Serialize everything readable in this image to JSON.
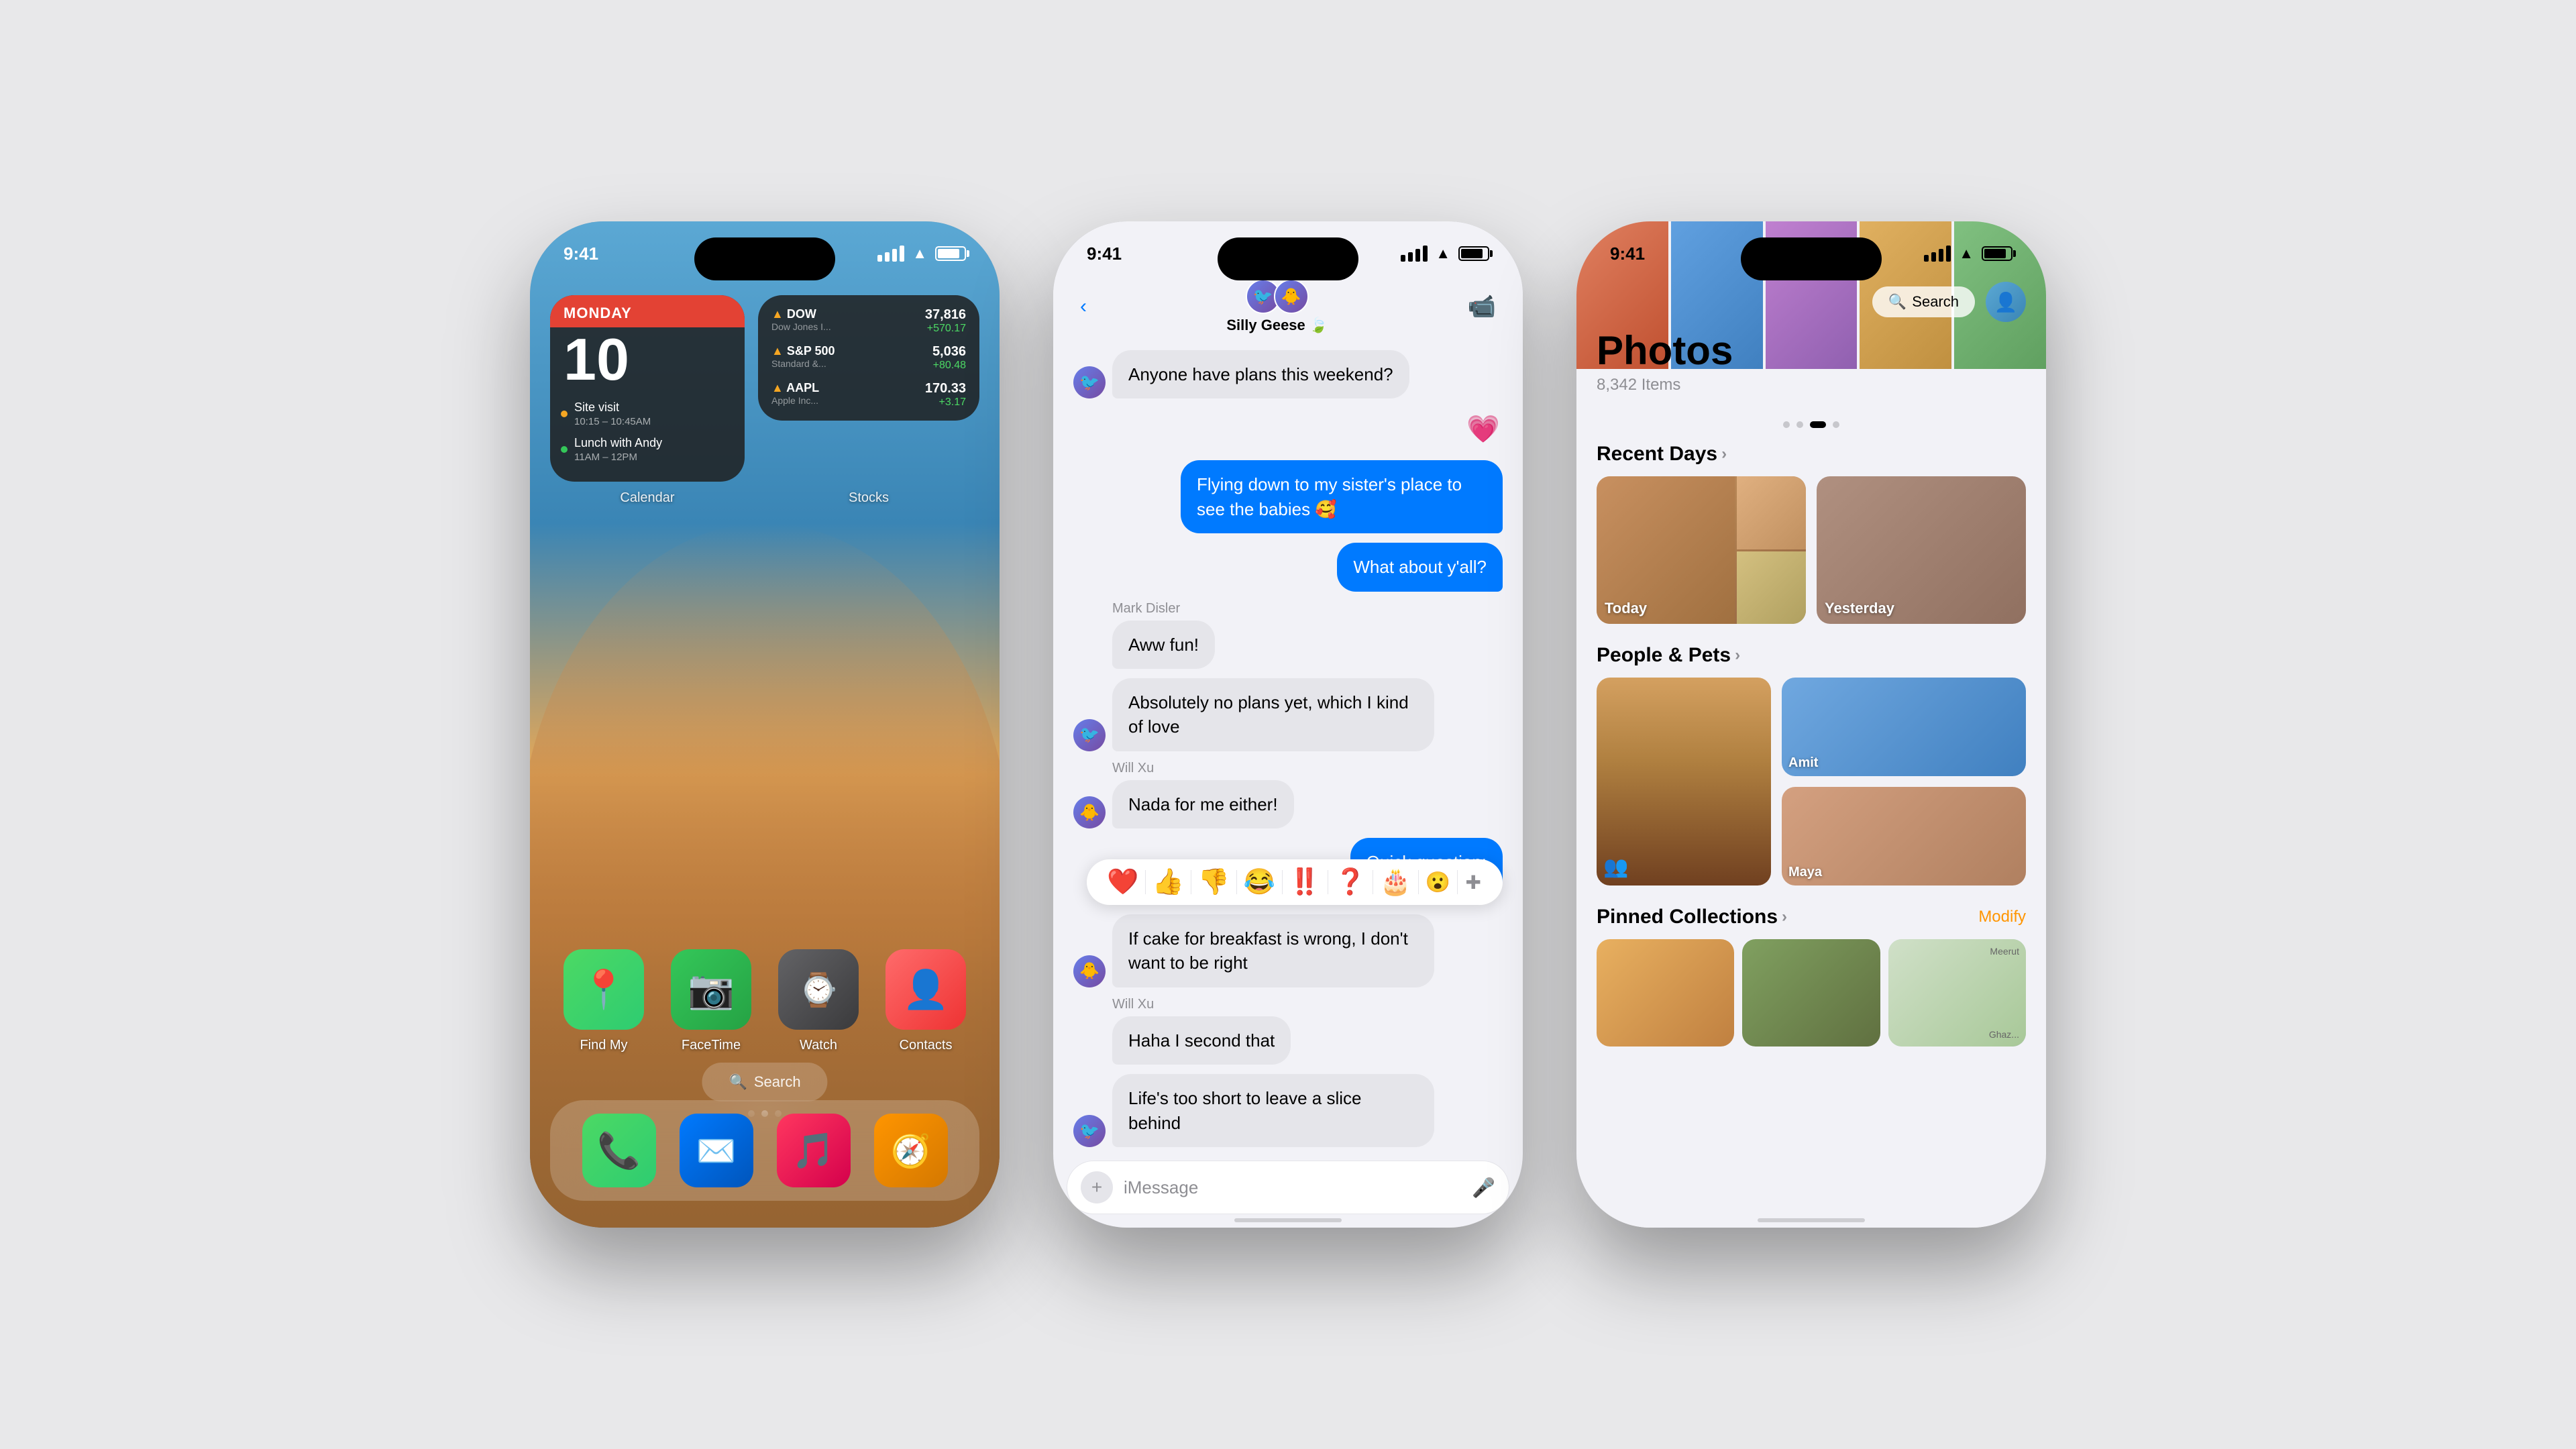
{
  "phone1": {
    "status": {
      "time": "9:41",
      "signal": "●●●●",
      "wifi": "wifi",
      "battery": "battery"
    },
    "calendar_widget": {
      "day_name": "MONDAY",
      "day_number": "10",
      "label": "Calendar",
      "events": [
        {
          "title": "Site visit",
          "time": "10:15 – 10:45AM"
        },
        {
          "title": "Lunch with Andy",
          "time": "11AM – 12PM"
        }
      ]
    },
    "stocks_widget": {
      "label": "Stocks",
      "items": [
        {
          "name": "DOW",
          "subname": "Dow Jones I...",
          "value": "37,816",
          "change": "+570.17",
          "arrow": "▲"
        },
        {
          "name": "S&P 500",
          "subname": "Standard &...",
          "value": "5,036",
          "change": "+80.48",
          "arrow": "▲"
        },
        {
          "name": "AAPL",
          "subname": "Apple Inc...",
          "value": "170.33",
          "change": "+3.17",
          "arrow": "▲"
        }
      ]
    },
    "apps": [
      {
        "name": "Find My",
        "emoji": "📍"
      },
      {
        "name": "FaceTime",
        "emoji": "📹"
      },
      {
        "name": "Watch",
        "emoji": "⌚"
      },
      {
        "name": "Contacts",
        "emoji": "👤"
      }
    ],
    "search": "Search",
    "dock": [
      {
        "name": "Phone",
        "emoji": "📞"
      },
      {
        "name": "Mail",
        "emoji": "✉️"
      },
      {
        "name": "Music",
        "emoji": "🎵"
      },
      {
        "name": "Compass",
        "emoji": "🧭"
      }
    ]
  },
  "phone2": {
    "status": {
      "time": "9:41"
    },
    "nav": {
      "back": "‹",
      "group_name": "Silly Geese 🍃",
      "video_call": "video"
    },
    "messages": [
      {
        "type": "theirs",
        "text": "Anyone have plans this weekend?",
        "has_avatar": true
      },
      {
        "type": "mine",
        "text": "💗",
        "is_emoji": true
      },
      {
        "type": "mine",
        "text": "Flying down to my sister's place to see the babies 🥰"
      },
      {
        "type": "mine",
        "text": "What about y'all?"
      },
      {
        "type": "sender_label",
        "text": "Mark Disler"
      },
      {
        "type": "theirs",
        "text": "Aww fun!"
      },
      {
        "type": "theirs",
        "text": "Absolutely no plans yet, which I kind of love",
        "has_avatar": true
      },
      {
        "type": "sender_label",
        "text": "Will Xu"
      },
      {
        "type": "theirs",
        "text": "Nada for me either!",
        "has_avatar": true
      },
      {
        "type": "mine",
        "text": "Quick question:"
      },
      {
        "type": "theirs",
        "text": "If cake for breakfast is wrong, I don't want to be right",
        "has_avatar": true
      },
      {
        "type": "sender_label",
        "text": "Will Xu"
      },
      {
        "type": "theirs",
        "text": "Haha I second that"
      },
      {
        "type": "theirs",
        "text": "Life's too short to leave a slice behind",
        "has_avatar": true
      }
    ],
    "tapback_emojis": [
      "❤️",
      "👍",
      "👎",
      "😂",
      "❗",
      "❓",
      "🎂",
      "😮"
    ],
    "input": {
      "placeholder": "iMessage",
      "add_icon": "+",
      "mic_icon": "🎤"
    }
  },
  "phone3": {
    "status": {
      "time": "9:41"
    },
    "header": {
      "title": "Photos",
      "count": "8,342 Items",
      "search": "Search",
      "search_icon": "🔍"
    },
    "sections": {
      "recent_days": {
        "title": "Recent Days",
        "items": [
          "Today",
          "Yesterday"
        ]
      },
      "people_pets": {
        "title": "People & Pets",
        "people": [
          "Amit",
          "Maya"
        ]
      },
      "pinned": {
        "title": "Pinned Collections",
        "modify": "Modify"
      }
    },
    "carousel_dots": [
      "inactive",
      "inactive",
      "active",
      "inactive"
    ]
  }
}
